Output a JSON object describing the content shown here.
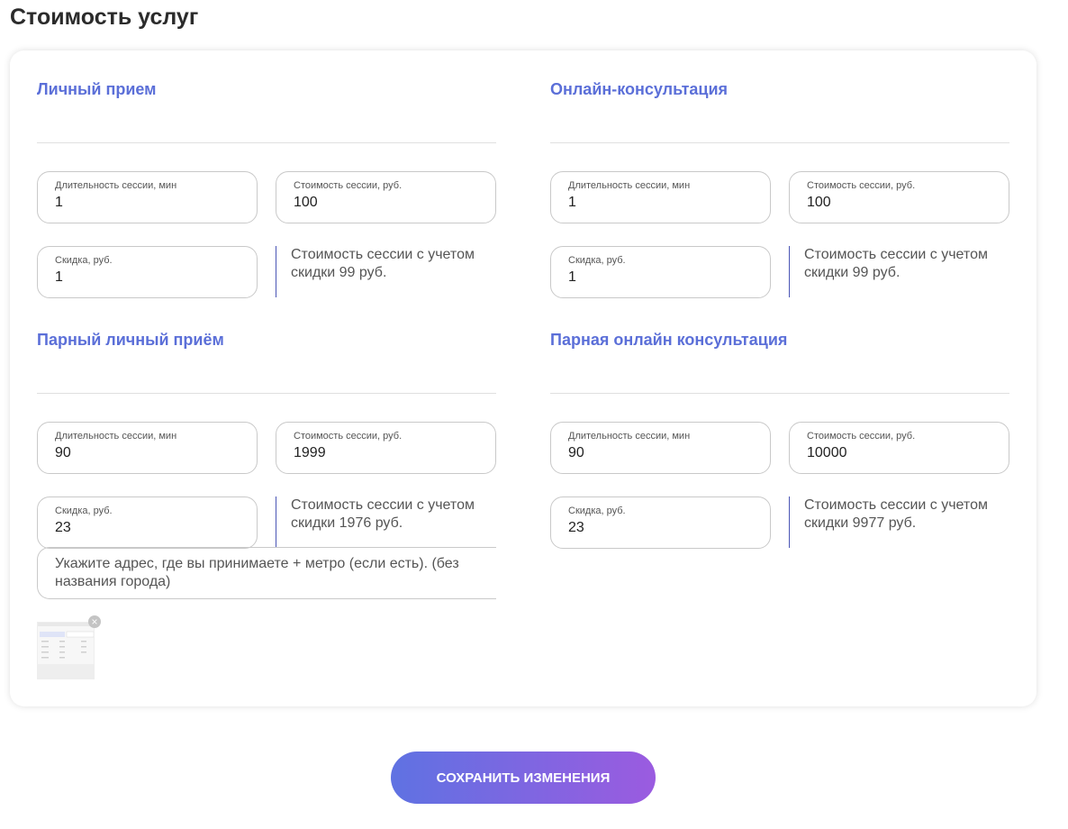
{
  "page_title": "Стоимость услуг",
  "sections": [
    {
      "title": "Личный прием",
      "duration": {
        "label": "Длительность сессии, мин",
        "value": "1"
      },
      "price": {
        "label": "Стоимость сессии, руб.",
        "value": "100"
      },
      "discount": {
        "label": "Скидка, руб.",
        "value": "1"
      },
      "note": "Стоимость сессии с учетом скидки 99 руб."
    },
    {
      "title": "Онлайн-консультация",
      "duration": {
        "label": "Длительность сессии, мин",
        "value": "1"
      },
      "price": {
        "label": "Стоимость сессии, руб.",
        "value": "100"
      },
      "discount": {
        "label": "Скидка, руб.",
        "value": "1"
      },
      "note": "Стоимость сессии с учетом скидки 99 руб."
    },
    {
      "title": "Парный личный приём",
      "duration": {
        "label": "Длительность сессии, мин",
        "value": "90"
      },
      "price": {
        "label": "Стоимость сессии, руб.",
        "value": "1999"
      },
      "discount": {
        "label": "Скидка, руб.",
        "value": "23"
      },
      "note": "Стоимость сессии с учетом скидки 1976 руб."
    },
    {
      "title": "Парная онлайн консультация",
      "duration": {
        "label": "Длительность сессии, мин",
        "value": "90"
      },
      "price": {
        "label": "Стоимость сессии, руб.",
        "value": "10000"
      },
      "discount": {
        "label": "Скидка, руб.",
        "value": "23"
      },
      "note": "Стоимость сессии с учетом скидки 9977 руб."
    }
  ],
  "address_placeholder": "Укажите адрес, где вы принимаете + метро (если есть). (без названия города)",
  "thumbnail": {
    "remove_icon": "close-icon"
  },
  "save_button_label": "СОХРАНИТЬ ИЗМЕНЕНИЯ",
  "colors": {
    "accent": "#5b6fd8",
    "button_gradient_start": "#5f72e2",
    "button_gradient_end": "#9b5be0",
    "divider_accent": "#4a55b5"
  }
}
